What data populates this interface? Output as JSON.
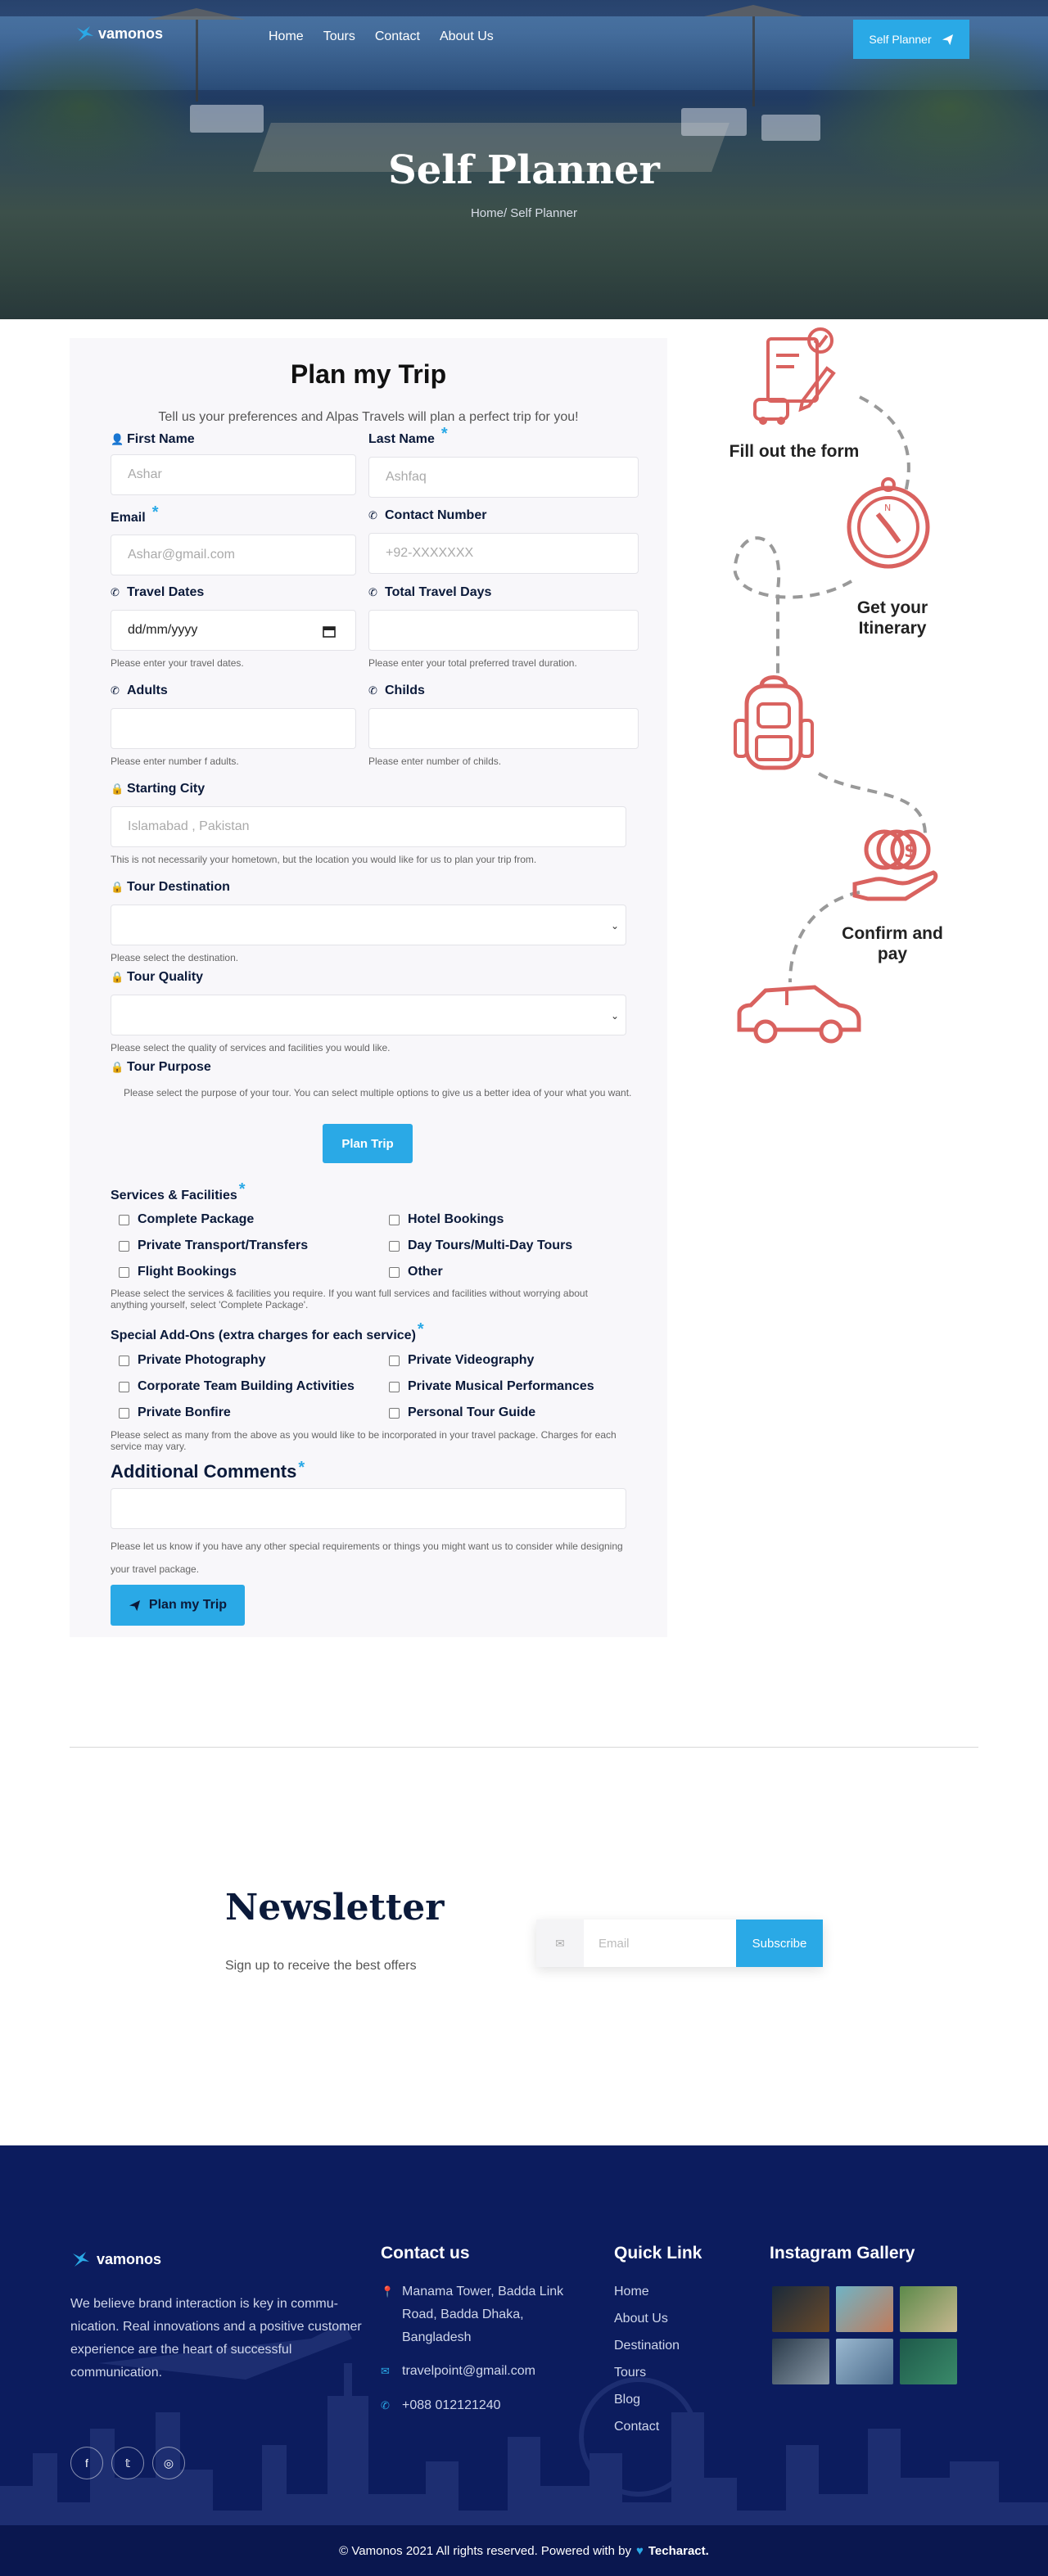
{
  "header": {
    "brand": "vamonos",
    "nav": [
      "Home",
      "Tours",
      "Contact",
      "About Us"
    ],
    "cta_label": "Self Planner"
  },
  "hero": {
    "title": "Self Planner",
    "breadcrumb": "Home/ Self Planner"
  },
  "form": {
    "title": "Plan my Trip",
    "subtitle": "Tell us your preferences and Alpas Travels will plan a perfect trip for you!",
    "first_name": {
      "label": "First Name",
      "placeholder": "Ashar"
    },
    "last_name": {
      "label": "Last Name",
      "placeholder": "Ashfaq"
    },
    "email": {
      "label": "Email",
      "placeholder": "Ashar@gmail.com"
    },
    "contact": {
      "label": "Contact Number",
      "placeholder": "+92-XXXXXXX"
    },
    "travel_dates": {
      "label": "Travel Dates",
      "value": "dd/mm/yyyy",
      "help": "Please enter your travel dates."
    },
    "total_days": {
      "label": "Total Travel Days",
      "help": "Please enter your total preferred travel duration."
    },
    "adults": {
      "label": "Adults",
      "help": "Please enter number f adults."
    },
    "childs": {
      "label": "Childs",
      "help": "Please enter number of childs."
    },
    "starting_city": {
      "label": "Starting City",
      "placeholder": "Islamabad , Pakistan",
      "help": "This is not necessarily your hometown, but the location you would like for us to plan your trip from."
    },
    "destination": {
      "label": "Tour Destination",
      "help": "Please select the destination."
    },
    "quality": {
      "label": "Tour Quality",
      "help": "Please select the quality of services and facilities you would like."
    },
    "purpose": {
      "label": "Tour Purpose",
      "help": "Please select the purpose of your tour. You can select multiple options to give us a better idea of your what you want."
    },
    "plan_button": "Plan Trip",
    "services": {
      "title": "Services & Facilities",
      "options": [
        "Complete Package",
        "Hotel Bookings",
        "Private Transport/Transfers",
        "Day Tours/Multi-Day Tours",
        "Flight Bookings",
        "Other"
      ],
      "help": "Please select the services & facilities you require. If you want full services and facilities without worrying about anything yourself, select 'Complete Package'."
    },
    "addons": {
      "title": "Special Add-Ons (extra charges for each service)",
      "options": [
        "Private Photography",
        "Private Videography",
        "Corporate Team Building Activities",
        "Private Musical Performances",
        "Private Bonfire",
        "Personal Tour Guide"
      ],
      "help": "Please select as many from the above as you would like to be incorporated in your travel package. Charges for each service may vary."
    },
    "comments": {
      "title": "Additional Comments",
      "help": "Please let us know if you have any other special requirements or things you might want us to consider while designing your travel package."
    },
    "submit_label": "Plan my Trip"
  },
  "steps": [
    "Fill out the form",
    "Get your Itinerary",
    "Confirm and pay"
  ],
  "newsletter": {
    "title": "Newsletter",
    "subtitle": "Sign up to receive the best offers",
    "placeholder": "Email",
    "button": "Subscribe"
  },
  "footer": {
    "brand": "vamonos",
    "about": "We believe brand interaction is key in commu- nication. Real innovations and a positive customer experience are the heart of successful communication.",
    "contact_title": "Contact us",
    "address": "Manama Tower, Badda Link Road, Badda Dhaka, Bangladesh",
    "email": "travelpoint@gmail.com",
    "phone": "+088 012121240",
    "quick_title": "Quick Link",
    "links": [
      "Home",
      "About Us",
      "Destination",
      "Tours",
      "Blog",
      "Contact"
    ],
    "gallery_title": "Instagram Gallery",
    "copyright": "© Vamonos 2021 All rights reserved. Powered with by",
    "powered": "Techaract."
  },
  "colors": {
    "accent": "#2aa9e6",
    "navy": "#0c1c5e",
    "icon": "#d9625f"
  }
}
